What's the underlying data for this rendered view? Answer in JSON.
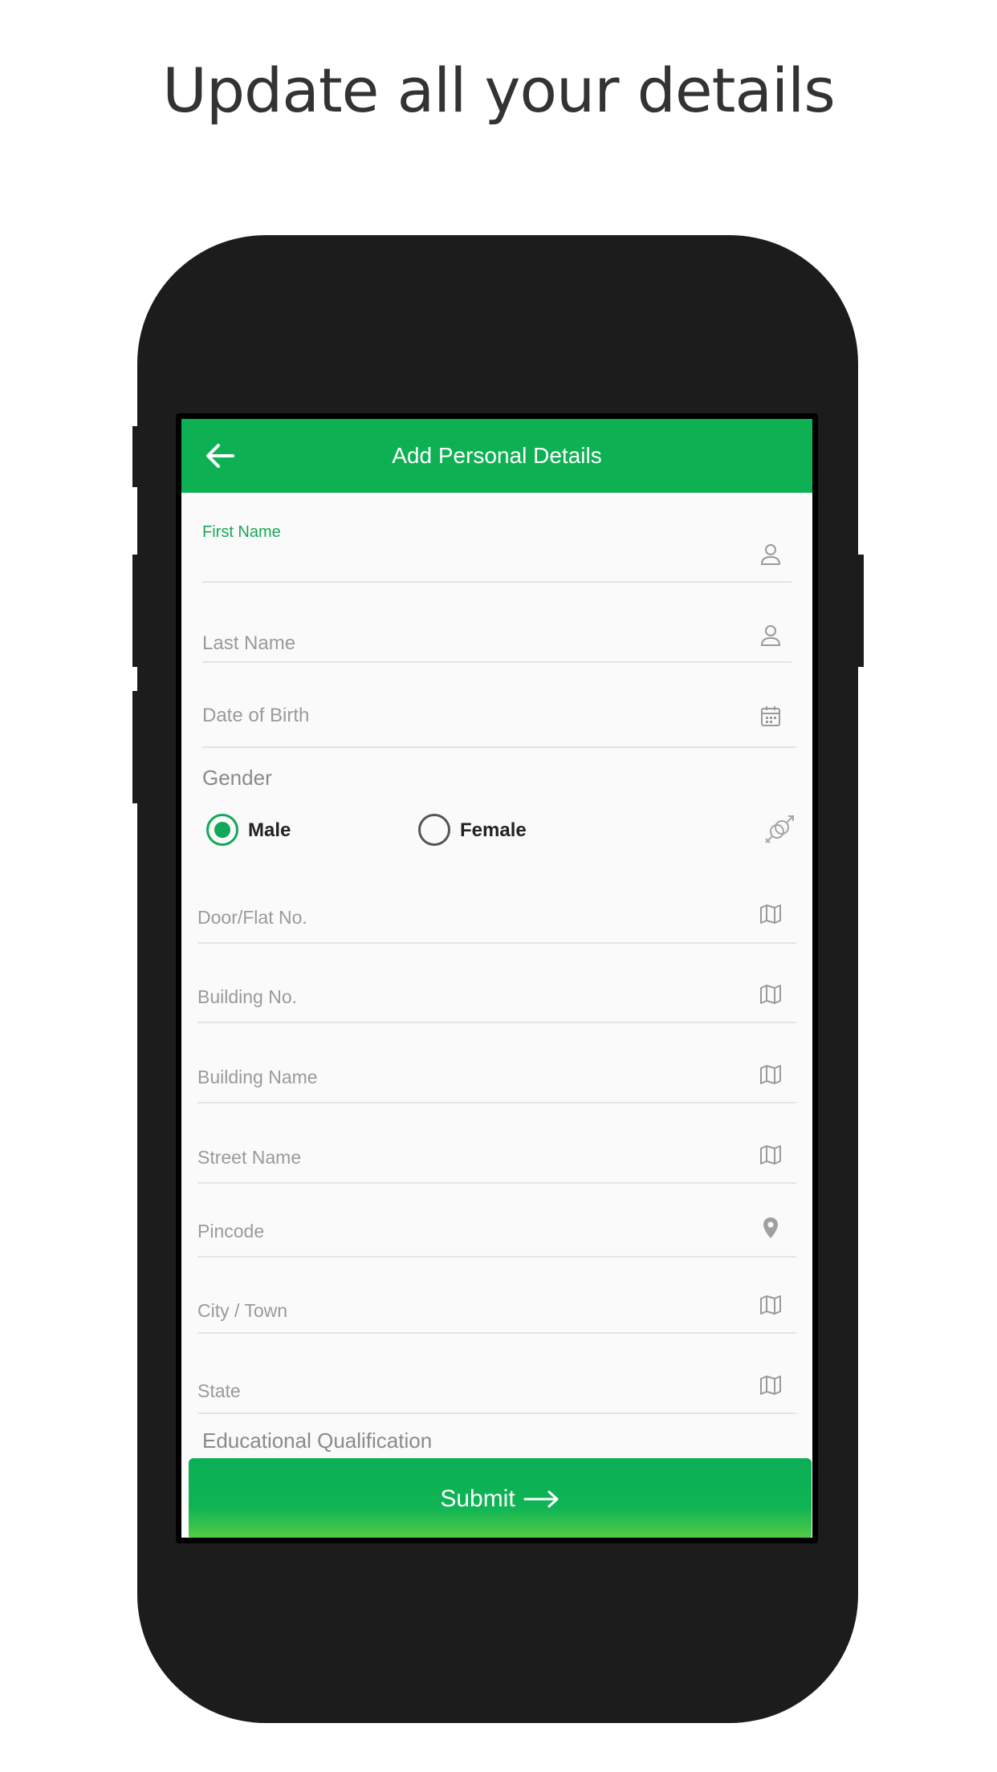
{
  "headline": "Update all your details",
  "appbar": {
    "title": "Add Personal Details"
  },
  "form": {
    "first_name_label": "First Name",
    "last_name_label": "Last Name",
    "dob_label": "Date of Birth",
    "gender_title": "Gender",
    "gender_options": [
      {
        "label": "Male",
        "selected": true
      },
      {
        "label": "Female",
        "selected": false
      }
    ],
    "door_label": "Door/Flat No.",
    "building_no_label": "Building No.",
    "building_name_label": "Building Name",
    "street_label": "Street Name",
    "pincode_label": "Pincode",
    "city_label": "City / Town",
    "state_label": "State",
    "education_label": "Educational Qualification"
  },
  "submit_label": "Submit",
  "icons": {
    "back": "arrow-left-icon",
    "person": "person-icon",
    "calendar": "calendar-icon",
    "gender": "gender-icon",
    "map": "map-icon",
    "pin": "location-pin-icon",
    "submit_arrow": "arrow-right-icon"
  },
  "colors": {
    "brand_green": "#0db154",
    "accent_green": "#13a858",
    "phone_frame": "#1c1c1c"
  }
}
